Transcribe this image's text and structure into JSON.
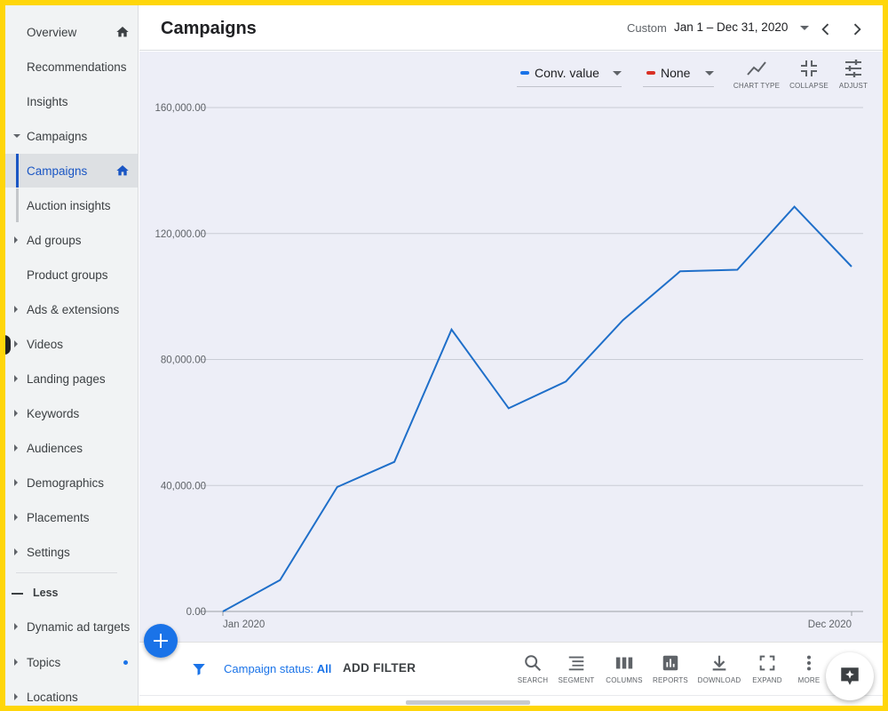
{
  "header": {
    "title": "Campaigns",
    "date_mode": "Custom",
    "date_range": "Jan 1 – Dec 31, 2020"
  },
  "sidebar": {
    "items": [
      {
        "label": "Overview"
      },
      {
        "label": "Recommendations"
      },
      {
        "label": "Insights"
      },
      {
        "label": "Campaigns"
      },
      {
        "label": "Campaigns"
      },
      {
        "label": "Auction insights"
      },
      {
        "label": "Ad groups"
      },
      {
        "label": "Product groups"
      },
      {
        "label": "Ads & extensions"
      },
      {
        "label": "Videos"
      },
      {
        "label": "Landing pages"
      },
      {
        "label": "Keywords"
      },
      {
        "label": "Audiences"
      },
      {
        "label": "Demographics"
      },
      {
        "label": "Placements"
      },
      {
        "label": "Settings"
      },
      {
        "label": "Dynamic ad targets"
      },
      {
        "label": "Topics"
      },
      {
        "label": "Locations"
      }
    ],
    "less_label": "Less"
  },
  "chart_controls": {
    "metric1": {
      "label": "Conv. value",
      "color": "#1a73e8"
    },
    "metric2": {
      "label": "None",
      "color": "#d93025"
    },
    "tools": [
      {
        "label": "CHART TYPE",
        "icon": "line-chart-icon"
      },
      {
        "label": "COLLAPSE",
        "icon": "collapse-icon"
      },
      {
        "label": "ADJUST",
        "icon": "sliders-icon"
      }
    ]
  },
  "chart_data": {
    "type": "line",
    "series": [
      {
        "name": "Conv. value",
        "color": "#1f6fc9",
        "values": [
          0,
          10000,
          39500,
          47500,
          89500,
          64500,
          73000,
          92500,
          108000,
          108500,
          128500,
          109500
        ]
      }
    ],
    "x_labels": [
      "Jan 2020",
      "Dec 2020"
    ],
    "ylim": [
      0,
      160000
    ],
    "yticks": [
      "0.00",
      "40,000.00",
      "80,000.00",
      "120,000.00",
      "160,000.00"
    ],
    "grid": true
  },
  "bottom_bar": {
    "status_filter_prefix": "Campaign status:",
    "status_filter_value": "All",
    "add_filter": "ADD FILTER",
    "tools": [
      {
        "label": "SEARCH",
        "icon": "search-icon"
      },
      {
        "label": "SEGMENT",
        "icon": "segment-icon"
      },
      {
        "label": "COLUMNS",
        "icon": "columns-icon"
      },
      {
        "label": "REPORTS",
        "icon": "reports-icon"
      },
      {
        "label": "DOWNLOAD",
        "icon": "download-icon"
      },
      {
        "label": "EXPAND",
        "icon": "expand-icon"
      },
      {
        "label": "MORE",
        "icon": "more-vert-icon"
      }
    ]
  }
}
